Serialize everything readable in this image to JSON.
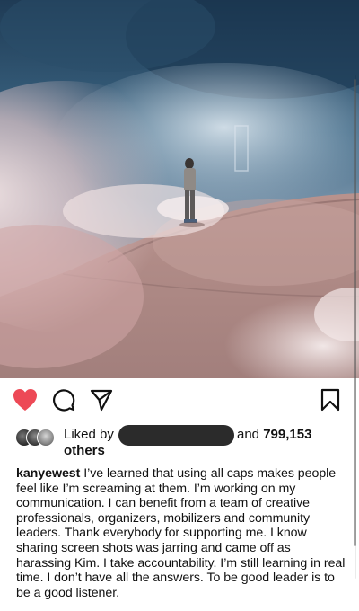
{
  "post": {
    "likes": {
      "prefix": "Liked by",
      "middle": "and",
      "count": "799,153",
      "others": "others"
    },
    "caption": {
      "username": "kanyewest",
      "text": " I’ve learned that using all caps makes people feel like I’m screaming at them. I’m working on my communication. I can benefit from a team of creative professionals, organizers,  mobilizers and community leaders. Thank everybody for supporting me. I know sharing screen shots was jarring and came off as harassing Kim. I take accountability. I’m still learning in real time. I don’t have all the answers. To be good leader is to be a good listener."
    }
  },
  "icons": {
    "like": "heart-filled-icon",
    "comment": "speech-bubble-icon",
    "share": "paper-plane-icon",
    "save": "bookmark-icon"
  },
  "colors": {
    "like_red": "#ed4956",
    "redaction": "#2b2b2b"
  }
}
